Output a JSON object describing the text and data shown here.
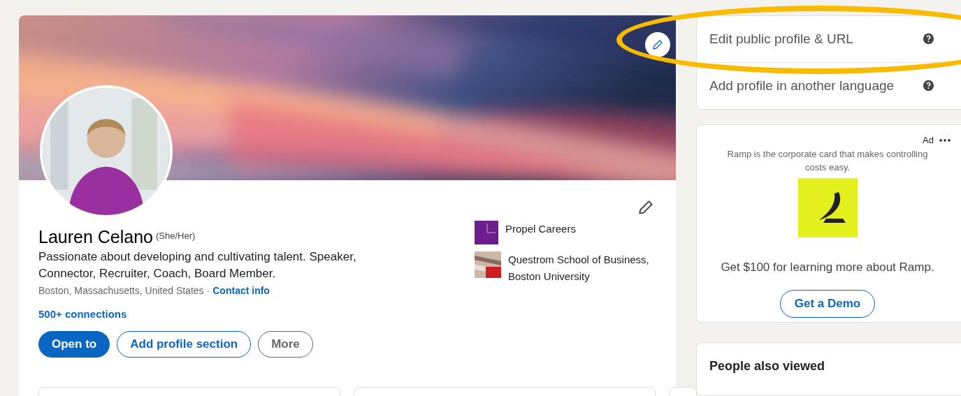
{
  "profile": {
    "name": "Lauren Celano",
    "pronouns": "(She/Her)",
    "headline": "Passionate about developing and cultivating talent. Speaker, Connector, Recruiter, Coach, Board Member.",
    "location": "Boston, Massachusetts, United States",
    "separator": "·",
    "contact_link": "Contact info",
    "connections": "500+ connections",
    "actions": [
      {
        "label": "Open to",
        "kind": "primary"
      },
      {
        "label": "Add profile section",
        "kind": "secondary"
      },
      {
        "label": "More",
        "kind": "tertiary"
      }
    ],
    "affiliations": [
      {
        "name": "Propel Careers",
        "kind": "company"
      },
      {
        "name": "Questrom School of Business, Boston University",
        "kind": "school"
      }
    ]
  },
  "sidebar": {
    "links": [
      {
        "label": "Edit public profile & URL"
      },
      {
        "label": "Add profile in another language"
      }
    ],
    "ad": {
      "label": "Ad",
      "text": "Ramp is the corporate card that makes controlling costs easy.",
      "offer": "Get $100 for learning more about Ramp.",
      "button": "Get a Demo"
    },
    "people_also_viewed": {
      "title": "People also viewed"
    }
  }
}
